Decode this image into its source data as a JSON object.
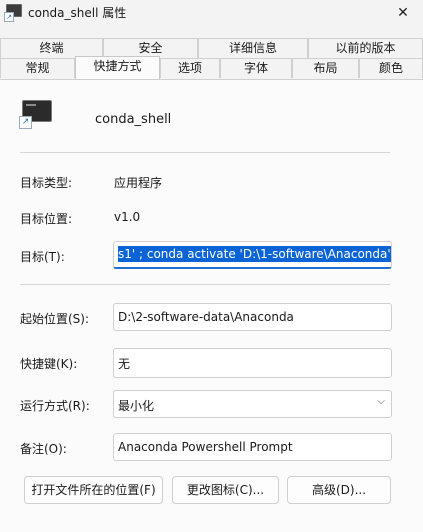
{
  "window": {
    "title": "conda_shell 属性",
    "close_glyph": "✕"
  },
  "tabs": {
    "row1": [
      "终端",
      "安全",
      "详细信息",
      "以前的版本"
    ],
    "row2": [
      "常规",
      "快捷方式",
      "选项",
      "字体",
      "布局",
      "颜色"
    ],
    "active": "快捷方式"
  },
  "shortcut": {
    "name": "conda_shell",
    "target_type_label": "目标类型:",
    "target_type_value": "应用程序",
    "target_location_label": "目标位置:",
    "target_location_value": "v1.0",
    "target_label": "目标(T):",
    "target_value": "s1' ; conda activate 'D:\\1-software\\Anaconda' \"",
    "start_in_label": "起始位置(S):",
    "start_in_value": "D:\\2-software-data\\Anaconda",
    "hotkey_label": "快捷键(K):",
    "hotkey_value": "无",
    "run_label": "运行方式(R):",
    "run_value": "最小化",
    "comment_label": "备注(O):",
    "comment_value": "Anaconda Powershell Prompt"
  },
  "buttons": {
    "open_location": "打开文件所在的位置(F)",
    "change_icon": "更改图标(C)...",
    "advanced": "高级(D)..."
  }
}
